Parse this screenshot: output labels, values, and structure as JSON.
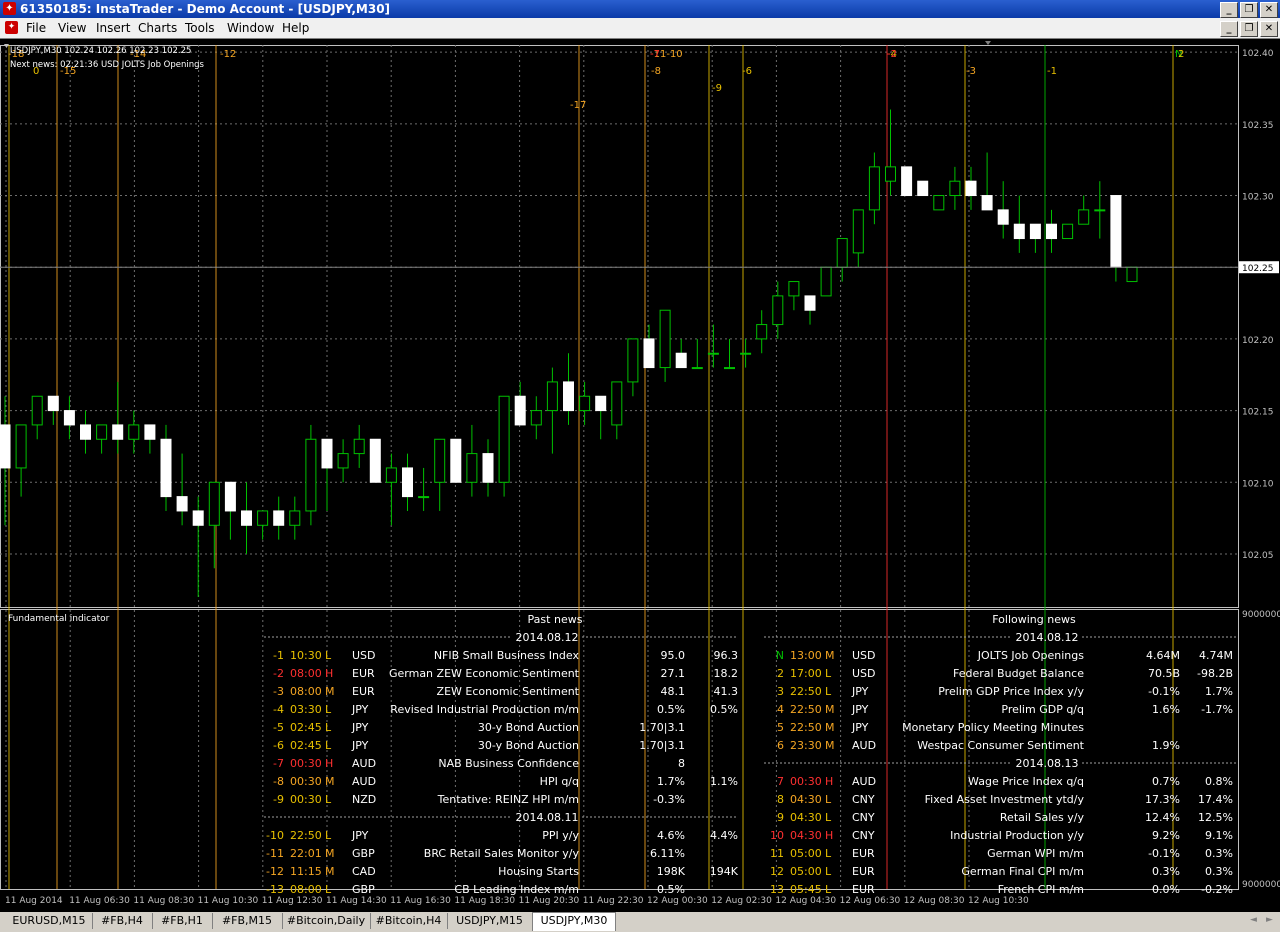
{
  "window": {
    "title": "61350185: InstaTrader - Demo Account - [USDJPY,M30]"
  },
  "menu": [
    "File",
    "View",
    "Insert",
    "Charts",
    "Tools",
    "Window",
    "Help"
  ],
  "chart": {
    "header": "USDJPY,M30  102.24 102.26 102.23 102.25",
    "next_news": "Next news: 02:21:36 USD JOLTS Job Openings",
    "price_labels": [
      "102.40",
      "102.35",
      "102.30",
      "102.25",
      "102.20",
      "102.15",
      "102.10",
      "102.05"
    ],
    "current_price": "102.25",
    "ymin": 102.013,
    "ymax": 102.405,
    "candles": [
      [
        102.14,
        102.16,
        102.07,
        102.11
      ],
      [
        102.11,
        102.14,
        102.09,
        102.14
      ],
      [
        102.14,
        102.16,
        102.13,
        102.16
      ],
      [
        102.16,
        102.16,
        102.14,
        102.15
      ],
      [
        102.15,
        102.16,
        102.13,
        102.14
      ],
      [
        102.14,
        102.15,
        102.12,
        102.13
      ],
      [
        102.13,
        102.14,
        102.12,
        102.14
      ],
      [
        102.14,
        102.17,
        102.12,
        102.13
      ],
      [
        102.13,
        102.15,
        102.12,
        102.14
      ],
      [
        102.14,
        102.14,
        102.12,
        102.13
      ],
      [
        102.13,
        102.14,
        102.08,
        102.09
      ],
      [
        102.09,
        102.12,
        102.07,
        102.08
      ],
      [
        102.08,
        102.09,
        102.02,
        102.07
      ],
      [
        102.07,
        102.1,
        102.04,
        102.1
      ],
      [
        102.1,
        102.1,
        102.06,
        102.08
      ],
      [
        102.08,
        102.1,
        102.05,
        102.07
      ],
      [
        102.07,
        102.08,
        102.06,
        102.08
      ],
      [
        102.08,
        102.09,
        102.06,
        102.07
      ],
      [
        102.07,
        102.09,
        102.06,
        102.08
      ],
      [
        102.08,
        102.14,
        102.07,
        102.13
      ],
      [
        102.13,
        102.13,
        102.08,
        102.11
      ],
      [
        102.11,
        102.13,
        102.1,
        102.12
      ],
      [
        102.12,
        102.14,
        102.11,
        102.13
      ],
      [
        102.13,
        102.13,
        102.1,
        102.1
      ],
      [
        102.1,
        102.12,
        102.07,
        102.11
      ],
      [
        102.11,
        102.12,
        102.08,
        102.09
      ],
      [
        102.09,
        102.11,
        102.08,
        102.09
      ],
      [
        102.1,
        102.13,
        102.08,
        102.13
      ],
      [
        102.13,
        102.13,
        102.1,
        102.1
      ],
      [
        102.1,
        102.14,
        102.09,
        102.12
      ],
      [
        102.12,
        102.13,
        102.09,
        102.1
      ],
      [
        102.1,
        102.16,
        102.09,
        102.16
      ],
      [
        102.16,
        102.17,
        102.14,
        102.14
      ],
      [
        102.14,
        102.16,
        102.13,
        102.15
      ],
      [
        102.15,
        102.18,
        102.12,
        102.17
      ],
      [
        102.17,
        102.19,
        102.14,
        102.15
      ],
      [
        102.15,
        102.17,
        102.14,
        102.16
      ],
      [
        102.16,
        102.16,
        102.13,
        102.15
      ],
      [
        102.14,
        102.17,
        102.13,
        102.17
      ],
      [
        102.17,
        102.2,
        102.16,
        102.2
      ],
      [
        102.2,
        102.21,
        102.18,
        102.18
      ],
      [
        102.18,
        102.22,
        102.17,
        102.22
      ],
      [
        102.19,
        102.2,
        102.18,
        102.18
      ],
      [
        102.18,
        102.2,
        102.18,
        102.18
      ],
      [
        102.19,
        102.21,
        102.18,
        102.19
      ],
      [
        102.18,
        102.2,
        102.18,
        102.18
      ],
      [
        102.19,
        102.2,
        102.18,
        102.19
      ],
      [
        102.2,
        102.22,
        102.19,
        102.21
      ],
      [
        102.21,
        102.24,
        102.2,
        102.23
      ],
      [
        102.23,
        102.24,
        102.22,
        102.24
      ],
      [
        102.23,
        102.23,
        102.21,
        102.22
      ],
      [
        102.23,
        102.25,
        102.23,
        102.25
      ],
      [
        102.25,
        102.26,
        102.24,
        102.27
      ],
      [
        102.26,
        102.29,
        102.25,
        102.29
      ],
      [
        102.29,
        102.33,
        102.28,
        102.32
      ],
      [
        102.31,
        102.36,
        102.3,
        102.32
      ],
      [
        102.32,
        102.32,
        102.3,
        102.3
      ],
      [
        102.31,
        102.31,
        102.3,
        102.3
      ],
      [
        102.29,
        102.3,
        102.29,
        102.3
      ],
      [
        102.3,
        102.32,
        102.29,
        102.31
      ],
      [
        102.31,
        102.32,
        102.29,
        102.3
      ],
      [
        102.3,
        102.33,
        102.29,
        102.29
      ],
      [
        102.29,
        102.31,
        102.27,
        102.28
      ],
      [
        102.28,
        102.3,
        102.26,
        102.27
      ],
      [
        102.28,
        102.28,
        102.26,
        102.27
      ],
      [
        102.28,
        102.29,
        102.26,
        102.27
      ],
      [
        102.27,
        102.28,
        102.27,
        102.28
      ],
      [
        102.28,
        102.3,
        102.28,
        102.29
      ],
      [
        102.29,
        102.31,
        102.27,
        102.29
      ],
      [
        102.3,
        102.3,
        102.24,
        102.25
      ],
      [
        102.24,
        102.25,
        102.24,
        102.25
      ]
    ],
    "xlabels": [
      "11 Aug 2014",
      "11 Aug 06:30",
      "11 Aug 08:30",
      "11 Aug 10:30",
      "11 Aug 12:30",
      "11 Aug 14:30",
      "11 Aug 16:30",
      "11 Aug 18:30",
      "11 Aug 20:30",
      "11 Aug 22:30",
      "12 Aug 00:30",
      "12 Aug 02:30",
      "12 Aug 04:30",
      "12 Aug 06:30",
      "12 Aug 08:30",
      "12 Aug 10:30"
    ],
    "news_marks": [
      {
        "label": "-18",
        "row": 0,
        "color": "#f5a623"
      },
      {
        "label": "0",
        "row": 1,
        "color": "#e8c000"
      },
      {
        "label": "-15",
        "row": 1,
        "color": "#f5a623"
      },
      {
        "label": "-14",
        "row": 0,
        "color": "#f5a623"
      },
      {
        "label": "-12",
        "row": 0,
        "color": "#f5a623"
      },
      {
        "label": "-17",
        "row": 2,
        "color": "#f5a623"
      },
      {
        "label": "-11-10",
        "row": 0,
        "color": "#f5a623"
      },
      {
        "label": "-7",
        "row": 0,
        "color": "#ff3030"
      },
      {
        "label": "-8",
        "row": 1,
        "color": "#f5a623"
      },
      {
        "label": "-9",
        "row": 2,
        "color": "#e8c000"
      },
      {
        "label": "-6",
        "row": 1,
        "color": "#e8c000"
      },
      {
        "label": "-4",
        "row": 0,
        "color": "#e8c000"
      },
      {
        "label": "-2",
        "row": 0,
        "color": "#ff3030"
      },
      {
        "label": "-3",
        "row": 1,
        "color": "#f5a623"
      },
      {
        "label": "-1",
        "row": 1,
        "color": "#e8c000"
      },
      {
        "label": "N",
        "row": 0,
        "color": "#00c000"
      },
      {
        "label": "2",
        "row": 0,
        "color": "#e8c000"
      },
      {
        "label": "9",
        "row": 0,
        "color": "#e8c000"
      }
    ]
  },
  "indicator": {
    "name": "Fundamental indicator",
    "right_top": "9000000",
    "right_bottom": "9000000",
    "past_title": "Past news",
    "following_title": "Following news",
    "past": [
      {
        "sep": "2014.08.12"
      },
      {
        "n": "-1",
        "time": "10:30",
        "imp": "L",
        "cur": "USD",
        "event": "NFIB Small Business Index",
        "a": "95.0",
        "b": "96.3",
        "color": "#e8c000"
      },
      {
        "n": "-2",
        "time": "08:00",
        "imp": "H",
        "cur": "EUR",
        "event": "German ZEW Economic Sentiment",
        "a": "27.1",
        "b": "18.2",
        "color": "#ff3030"
      },
      {
        "n": "-3",
        "time": "08:00",
        "imp": "M",
        "cur": "EUR",
        "event": "ZEW Economic Sentiment",
        "a": "48.1",
        "b": "41.3",
        "color": "#f5a623"
      },
      {
        "n": "-4",
        "time": "03:30",
        "imp": "L",
        "cur": "JPY",
        "event": "Revised Industrial Production m/m",
        "a": "0.5%",
        "b": "0.5%",
        "color": "#e8c000"
      },
      {
        "n": "-5",
        "time": "02:45",
        "imp": "L",
        "cur": "JPY",
        "event": "30-y Bond Auction",
        "a": "1.70|3.1",
        "b": "",
        "color": "#e8c000"
      },
      {
        "n": "-6",
        "time": "02:45",
        "imp": "L",
        "cur": "JPY",
        "event": "30-y Bond Auction",
        "a": "1.70|3.1",
        "b": "",
        "color": "#e8c000"
      },
      {
        "n": "-7",
        "time": "00:30",
        "imp": "H",
        "cur": "AUD",
        "event": "NAB Business Confidence",
        "a": "8",
        "b": "",
        "color": "#ff3030"
      },
      {
        "n": "-8",
        "time": "00:30",
        "imp": "M",
        "cur": "AUD",
        "event": "HPI q/q",
        "a": "1.7%",
        "b": "1.1%",
        "color": "#f5a623"
      },
      {
        "n": "-9",
        "time": "00:30",
        "imp": "L",
        "cur": "NZD",
        "event": "Tentative: REINZ HPI m/m",
        "a": "-0.3%",
        "b": "",
        "color": "#e8c000"
      },
      {
        "sep": "2014.08.11"
      },
      {
        "n": "-10",
        "time": "22:50",
        "imp": "L",
        "cur": "JPY",
        "event": "PPI y/y",
        "a": "4.6%",
        "b": "4.4%",
        "color": "#e8c000"
      },
      {
        "n": "-11",
        "time": "22:01",
        "imp": "M",
        "cur": "GBP",
        "event": "BRC Retail Sales Monitor y/y",
        "a": "6.11%",
        "b": "",
        "color": "#f5a623"
      },
      {
        "n": "-12",
        "time": "11:15",
        "imp": "M",
        "cur": "CAD",
        "event": "Housing Starts",
        "a": "198K",
        "b": "194K",
        "color": "#f5a623"
      },
      {
        "n": "-13",
        "time": "08:00",
        "imp": "L",
        "cur": "GBP",
        "event": "CB Leading Index m/m",
        "a": "0.5%",
        "b": "",
        "color": "#e8c000"
      }
    ],
    "following": [
      {
        "sep": "2014.08.12"
      },
      {
        "n": "N",
        "time": "13:00",
        "imp": "M",
        "cur": "USD",
        "event": "JOLTS Job Openings",
        "a": "4.64M",
        "b": "4.74M",
        "color": "#00c000",
        "tcolor": "#f5a623"
      },
      {
        "n": "2",
        "time": "17:00",
        "imp": "L",
        "cur": "USD",
        "event": "Federal Budget Balance",
        "a": "70.5B",
        "b": "-98.2B",
        "color": "#e8c000"
      },
      {
        "n": "3",
        "time": "22:50",
        "imp": "L",
        "cur": "JPY",
        "event": "Prelim GDP Price Index y/y",
        "a": "-0.1%",
        "b": "1.7%",
        "color": "#e8c000"
      },
      {
        "n": "4",
        "time": "22:50",
        "imp": "M",
        "cur": "JPY",
        "event": "Prelim GDP q/q",
        "a": "1.6%",
        "b": "-1.7%",
        "color": "#f5a623"
      },
      {
        "n": "5",
        "time": "22:50",
        "imp": "M",
        "cur": "JPY",
        "event": "Monetary Policy Meeting Minutes",
        "a": "",
        "b": "",
        "color": "#f5a623"
      },
      {
        "n": "6",
        "time": "23:30",
        "imp": "M",
        "cur": "AUD",
        "event": "Westpac Consumer Sentiment",
        "a": "1.9%",
        "b": "",
        "color": "#f5a623"
      },
      {
        "sep": "2014.08.13"
      },
      {
        "n": "7",
        "time": "00:30",
        "imp": "H",
        "cur": "AUD",
        "event": "Wage Price Index q/q",
        "a": "0.7%",
        "b": "0.8%",
        "color": "#ff3030"
      },
      {
        "n": "8",
        "time": "04:30",
        "imp": "L",
        "cur": "CNY",
        "event": "Fixed Asset Investment ytd/y",
        "a": "17.3%",
        "b": "17.4%",
        "color": "#e8c000",
        "tcolor": "#f5a623"
      },
      {
        "n": "9",
        "time": "04:30",
        "imp": "L",
        "cur": "CNY",
        "event": "Retail Sales y/y",
        "a": "12.4%",
        "b": "12.5%",
        "color": "#e8c000"
      },
      {
        "n": "10",
        "time": "04:30",
        "imp": "H",
        "cur": "CNY",
        "event": "Industrial Production y/y",
        "a": "9.2%",
        "b": "9.1%",
        "color": "#ff3030"
      },
      {
        "n": "11",
        "time": "05:00",
        "imp": "L",
        "cur": "EUR",
        "event": "German WPI m/m",
        "a": "-0.1%",
        "b": "0.3%",
        "color": "#e8c000"
      },
      {
        "n": "12",
        "time": "05:00",
        "imp": "L",
        "cur": "EUR",
        "event": "German Final CPI m/m",
        "a": "0.3%",
        "b": "0.3%",
        "color": "#e8c000"
      },
      {
        "n": "13",
        "time": "05:45",
        "imp": "L",
        "cur": "EUR",
        "event": "French CPI m/m",
        "a": "0.0%",
        "b": "-0.2%",
        "color": "#e8c000"
      }
    ]
  },
  "tabs": [
    "EURUSD,M15",
    "#FB,H4",
    "#FB,H1",
    "#FB,M15",
    "#Bitcoin,Daily",
    "#Bitcoin,H4",
    "USDJPY,M15",
    "USDJPY,M30"
  ],
  "active_tab": "USDJPY,M30",
  "colors": {
    "bull": "#00c000",
    "bear_body": "#ffffff",
    "grid": "#6e6e6e",
    "low": "#e8c000",
    "medium": "#f5a623",
    "high": "#ff3030",
    "next": "#00c000"
  },
  "icons": {
    "app": "instatrader-icon",
    "minimize": "minimize-icon",
    "restore": "restore-icon",
    "close": "close-icon"
  }
}
